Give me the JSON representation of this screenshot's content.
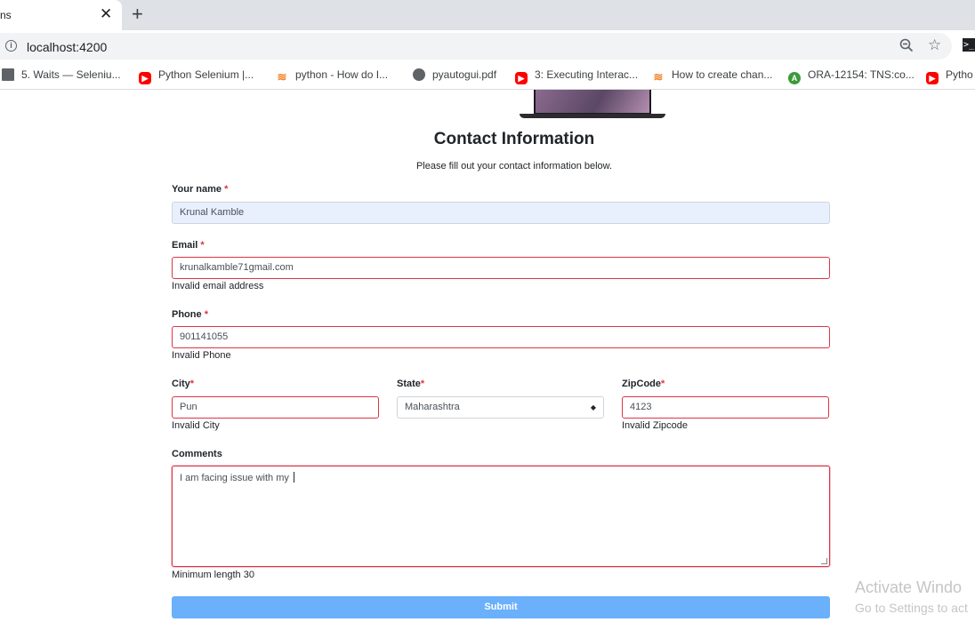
{
  "browser": {
    "tab_title": "ns",
    "tab_close": "✕",
    "new_tab": "+",
    "url": "localhost:4200",
    "bookmarks": [
      {
        "label": "5. Waits — Seleniu...",
        "icon": "doc-grid-icon"
      },
      {
        "label": "Python Selenium |...",
        "icon": "youtube-icon"
      },
      {
        "label": "python - How do I...",
        "icon": "stackoverflow-icon"
      },
      {
        "label": "pyautogui.pdf",
        "icon": "globe-icon"
      },
      {
        "label": "3: Executing Interac...",
        "icon": "youtube-icon"
      },
      {
        "label": "How to create chan...",
        "icon": "stackoverflow-icon"
      },
      {
        "label": "ORA-12154: TNS:co...",
        "icon": "angular-icon"
      },
      {
        "label": "Pytho",
        "icon": "youtube-icon"
      }
    ]
  },
  "form": {
    "title": "Contact Information",
    "subtitle": "Please fill out your contact information below.",
    "required_mark": "*",
    "name": {
      "label": "Your name",
      "value": "Krunal Kamble"
    },
    "email": {
      "label": "Email",
      "value": "krunalkamble71gmail.com",
      "error": "Invalid email address"
    },
    "phone": {
      "label": "Phone",
      "value": "901141055",
      "error": "Invalid Phone"
    },
    "city": {
      "label": "City",
      "value": "Pun",
      "error": "Invalid City"
    },
    "state": {
      "label": "State",
      "value": "Maharashtra",
      "arrow": "▲▼"
    },
    "zip": {
      "label": "ZipCode",
      "value": "4123",
      "error": "Invalid Zipcode"
    },
    "comments": {
      "label": "Comments",
      "value": "I am facing issue with my ",
      "error": "Minimum length 30"
    },
    "submit_label": "Submit"
  },
  "watermark": {
    "line1": "Activate Windo",
    "line2": "Go to Settings to act"
  },
  "colors": {
    "error_border": "#dc3545",
    "submit_bg": "#6ab0fb",
    "autofill_bg": "#e8f0fe"
  }
}
